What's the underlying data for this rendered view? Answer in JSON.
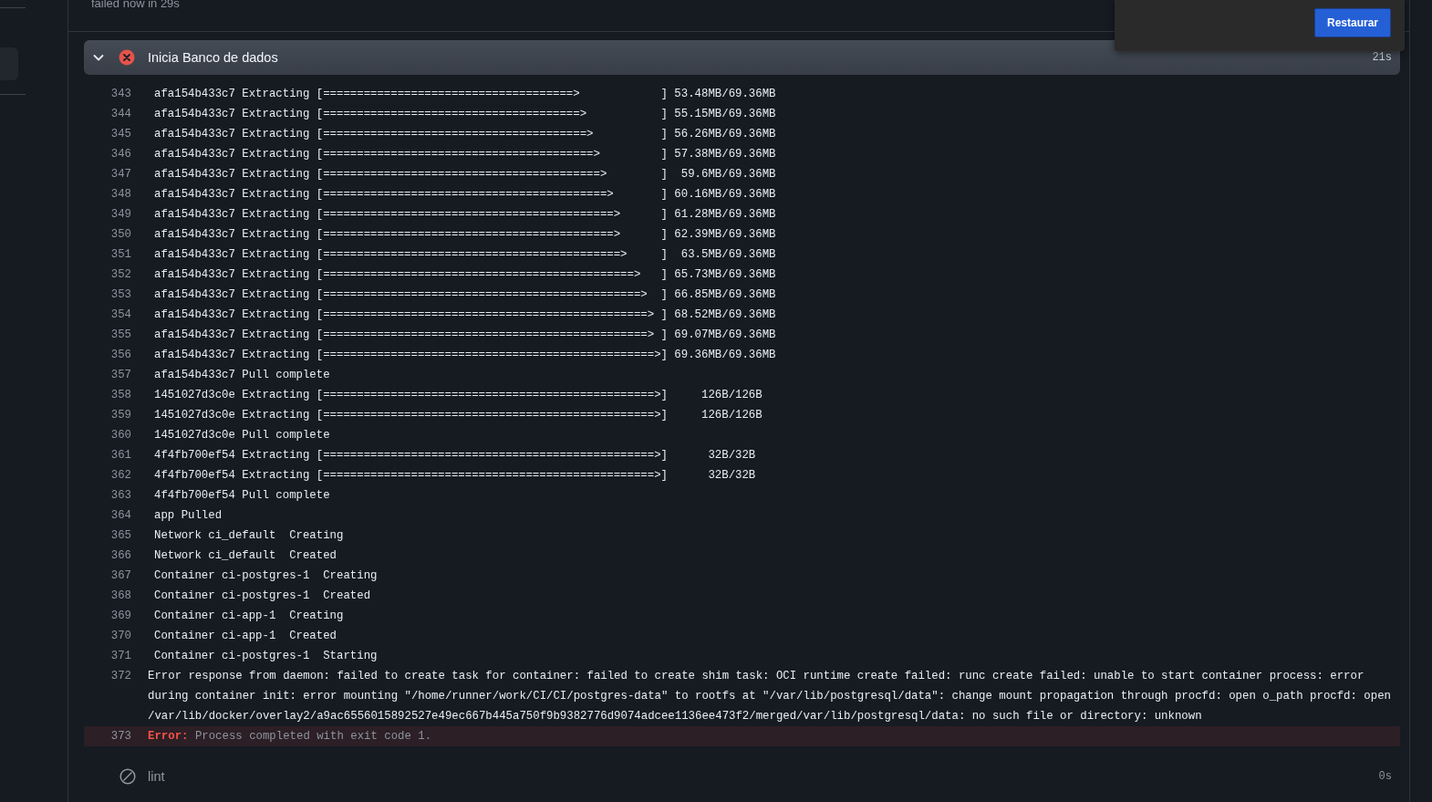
{
  "run": {
    "status": "failed now in 29s"
  },
  "step": {
    "title": "Inicia Banco de dados",
    "kind": "failed",
    "expanded": true,
    "duration": "21s"
  },
  "log": [
    {
      "num": "343",
      "kind": "compose",
      "text": "afa154b433c7 Extracting [=====================================>            ] 53.48MB/69.36MB"
    },
    {
      "num": "344",
      "kind": "compose",
      "text": "afa154b433c7 Extracting [======================================>           ] 55.15MB/69.36MB"
    },
    {
      "num": "345",
      "kind": "compose",
      "text": "afa154b433c7 Extracting [=======================================>          ] 56.26MB/69.36MB"
    },
    {
      "num": "346",
      "kind": "compose",
      "text": "afa154b433c7 Extracting [========================================>         ] 57.38MB/69.36MB"
    },
    {
      "num": "347",
      "kind": "compose",
      "text": "afa154b433c7 Extracting [=========================================>        ]  59.6MB/69.36MB"
    },
    {
      "num": "348",
      "kind": "compose",
      "text": "afa154b433c7 Extracting [==========================================>       ] 60.16MB/69.36MB"
    },
    {
      "num": "349",
      "kind": "compose",
      "text": "afa154b433c7 Extracting [===========================================>      ] 61.28MB/69.36MB"
    },
    {
      "num": "350",
      "kind": "compose",
      "text": "afa154b433c7 Extracting [===========================================>      ] 62.39MB/69.36MB"
    },
    {
      "num": "351",
      "kind": "compose",
      "text": "afa154b433c7 Extracting [============================================>     ]  63.5MB/69.36MB"
    },
    {
      "num": "352",
      "kind": "compose",
      "text": "afa154b433c7 Extracting [==============================================>   ] 65.73MB/69.36MB"
    },
    {
      "num": "353",
      "kind": "compose",
      "text": "afa154b433c7 Extracting [===============================================>  ] 66.85MB/69.36MB"
    },
    {
      "num": "354",
      "kind": "compose",
      "text": "afa154b433c7 Extracting [================================================> ] 68.52MB/69.36MB"
    },
    {
      "num": "355",
      "kind": "compose",
      "text": "afa154b433c7 Extracting [================================================> ] 69.07MB/69.36MB"
    },
    {
      "num": "356",
      "kind": "compose",
      "text": "afa154b433c7 Extracting [=================================================>] 69.36MB/69.36MB"
    },
    {
      "num": "357",
      "kind": "compose",
      "text": "afa154b433c7 Pull complete"
    },
    {
      "num": "358",
      "kind": "compose",
      "text": "1451027d3c0e Extracting [=================================================>]     126B/126B"
    },
    {
      "num": "359",
      "kind": "compose",
      "text": "1451027d3c0e Extracting [=================================================>]     126B/126B"
    },
    {
      "num": "360",
      "kind": "compose",
      "text": "1451027d3c0e Pull complete"
    },
    {
      "num": "361",
      "kind": "compose",
      "text": "4f4fb700ef54 Extracting [=================================================>]      32B/32B"
    },
    {
      "num": "362",
      "kind": "compose",
      "text": "4f4fb700ef54 Extracting [=================================================>]      32B/32B"
    },
    {
      "num": "363",
      "kind": "compose",
      "text": "4f4fb700ef54 Pull complete"
    },
    {
      "num": "364",
      "kind": "compose",
      "text": "app Pulled"
    },
    {
      "num": "365",
      "kind": "compose",
      "text": "Network ci_default  Creating"
    },
    {
      "num": "366",
      "kind": "compose",
      "text": "Network ci_default  Created"
    },
    {
      "num": "367",
      "kind": "compose",
      "text": "Container ci-postgres-1  Creating"
    },
    {
      "num": "368",
      "kind": "compose",
      "text": "Container ci-postgres-1  Created"
    },
    {
      "num": "369",
      "kind": "compose",
      "text": "Container ci-app-1  Creating"
    },
    {
      "num": "370",
      "kind": "compose",
      "text": "Container ci-app-1  Created"
    },
    {
      "num": "371",
      "kind": "compose",
      "text": "Container ci-postgres-1  Starting"
    },
    {
      "num": "372",
      "kind": "plain",
      "text": "Error response from daemon: failed to create task for container: failed to create shim task: OCI runtime create failed: runc create failed: unable to start container process: error during container init: error mounting \"/home/runner/work/CI/CI/postgres-data\" to rootfs at \"/var/lib/postgresql/data\": change mount propagation through procfd: open o_path procfd: open /var/lib/docker/overlay2/a9ac6556015892527e49ec667b445a750f9b9382776d9074adcee1136ee473f2/merged/var/lib/postgresql/data: no such file or directory: unknown"
    },
    {
      "num": "373",
      "kind": "error",
      "label": "Error:",
      "text": "Process completed with exit code 1."
    }
  ],
  "next_step": {
    "title": "lint",
    "kind": "skipped",
    "duration": "0s"
  },
  "popup": {
    "button": "Restaurar"
  }
}
